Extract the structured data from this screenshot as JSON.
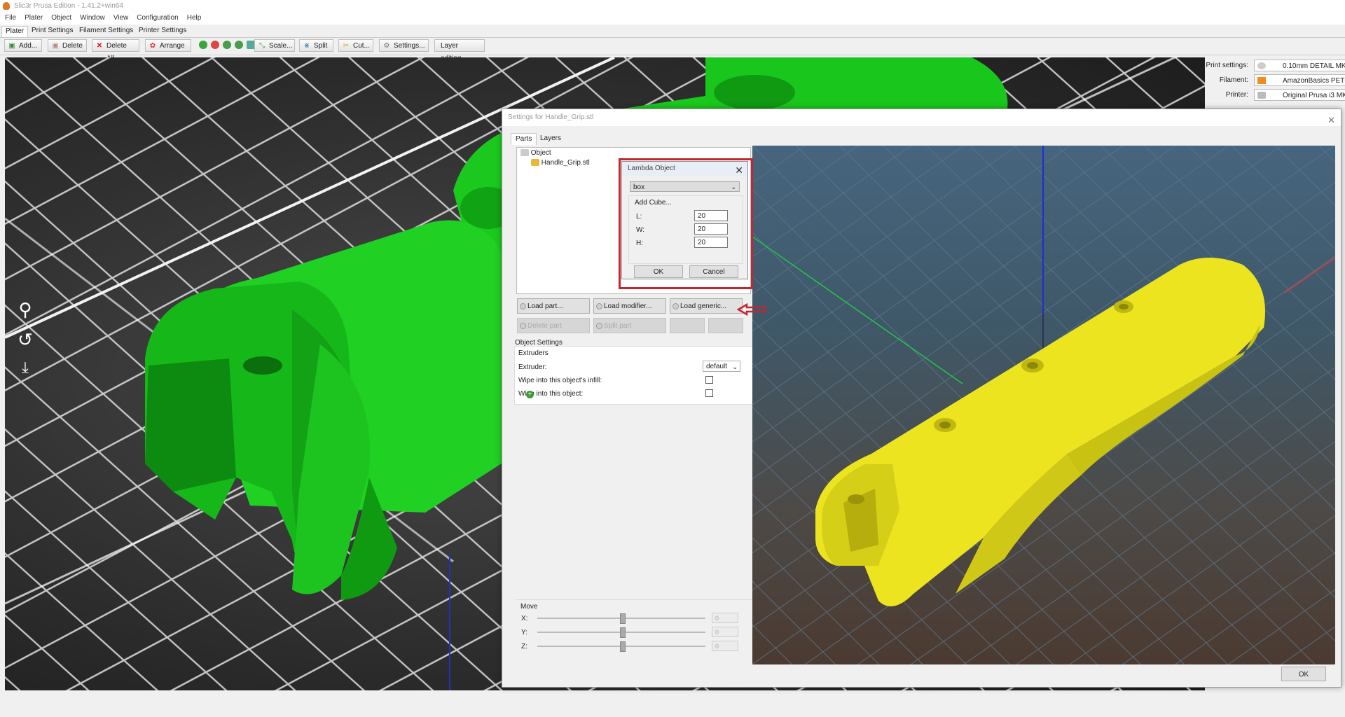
{
  "window": {
    "title": "Slic3r Prusa Edition - 1.41.2+win64"
  },
  "menu": [
    "File",
    "Plater",
    "Object",
    "Window",
    "View",
    "Configuration",
    "Help"
  ],
  "tabs": [
    "Plater",
    "Print Settings",
    "Filament Settings",
    "Printer Settings"
  ],
  "toolbar": {
    "add": "Add...",
    "delete": "Delete",
    "delete_all": "Delete All",
    "arrange": "Arrange",
    "scale": "Scale...",
    "split": "Split",
    "cut": "Cut...",
    "settings": "Settings...",
    "layer_editing": "Layer editing"
  },
  "right_panel": {
    "print_settings_label": "Print settings:",
    "print_settings_value": "0.10mm DETAIL MK",
    "filament_label": "Filament:",
    "filament_value": "AmazonBasics PETG",
    "filament_color": "#f28c1e",
    "printer_label": "Printer:",
    "printer_value": "Original Prusa i3 MK"
  },
  "dialog": {
    "title": "Settings for Handle_Grip.stl",
    "tabs": [
      "Parts",
      "Layers"
    ],
    "tree": {
      "root": "Object",
      "child": "Handle_Grip.stl"
    },
    "buttons": {
      "load_part": "Load part...",
      "load_modifier": "Load modifier...",
      "load_generic": "Load generic...",
      "delete_part": "Delete part",
      "split_part": "Split part"
    },
    "object_settings": {
      "group_label": "Object Settings",
      "extruders_label": "Extruders",
      "extruder_label": "Extruder:",
      "extruder_value": "default",
      "wipe_infill_label": "Wipe into this object's infill:",
      "wipe_object_label": "Wipe into this object:"
    },
    "move": {
      "label": "Move",
      "x_label": "X:",
      "x_value": "0",
      "y_label": "Y:",
      "y_value": "0",
      "z_label": "Z:",
      "z_value": "0"
    },
    "ok": "OK"
  },
  "lambda": {
    "title": "Lambda Object",
    "type": "box",
    "section": "Add Cube...",
    "l_label": "L:",
    "l_value": "20",
    "w_label": "W:",
    "w_value": "20",
    "h_label": "H:",
    "h_value": "20",
    "ok": "OK",
    "cancel": "Cancel"
  },
  "colors": {
    "model_green": "#17c41a",
    "model_yellow": "#e6e01a",
    "highlight_red": "#c1272d"
  }
}
